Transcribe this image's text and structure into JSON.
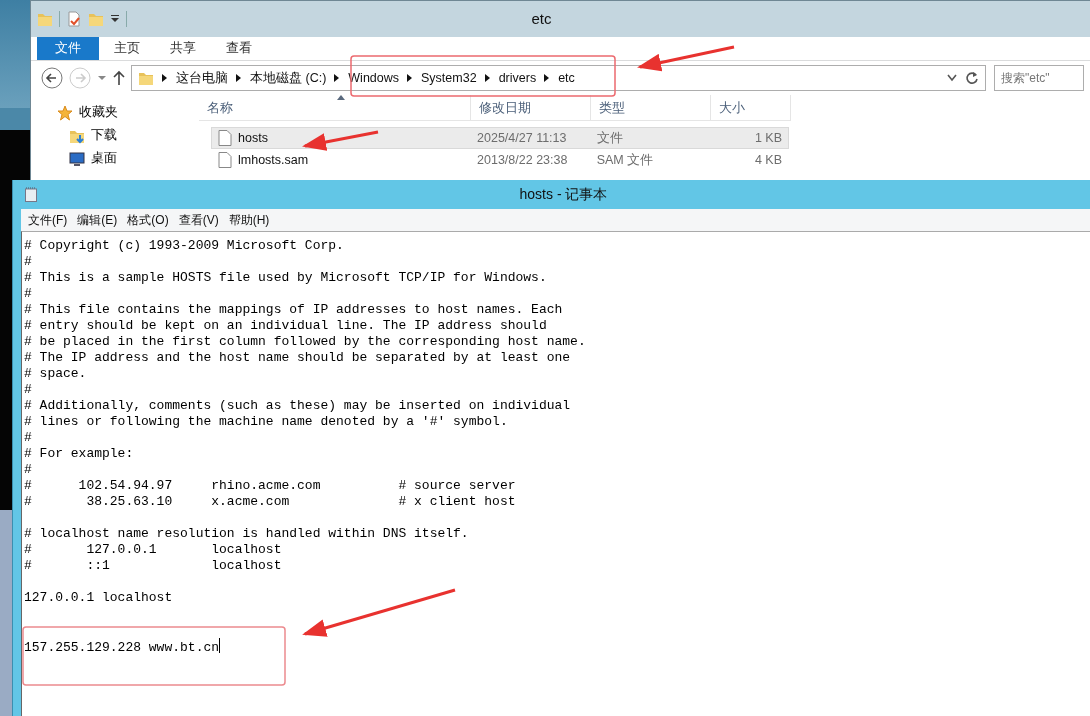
{
  "explorer": {
    "title": "etc",
    "ribbon_tabs": [
      {
        "label": "文件",
        "selected": true
      },
      {
        "label": "主页",
        "selected": false
      },
      {
        "label": "共享",
        "selected": false
      },
      {
        "label": "查看",
        "selected": false
      }
    ],
    "breadcrumb": [
      "这台电脑",
      "本地磁盘 (C:)",
      "Windows",
      "System32",
      "drivers",
      "etc"
    ],
    "search": {
      "placeholder": "搜索\"etc\""
    },
    "nav_pane": [
      {
        "label": "收藏夹",
        "kind": "star"
      },
      {
        "label": "下载",
        "kind": "download"
      },
      {
        "label": "桌面",
        "kind": "desktop"
      }
    ],
    "columns": [
      "名称",
      "修改日期",
      "类型",
      "大小"
    ],
    "rows": [
      {
        "name": "hosts",
        "date": "2025/4/27 11:13",
        "type": "文件",
        "size": "1 KB",
        "selected": true
      },
      {
        "name": "lmhosts.sam",
        "date": "2013/8/22 23:38",
        "type": "SAM 文件",
        "size": "4 KB",
        "selected": false
      }
    ]
  },
  "notepad": {
    "title": "hosts - 记事本",
    "menu": [
      "文件(F)",
      "编辑(E)",
      "格式(O)",
      "查看(V)",
      "帮助(H)"
    ],
    "lines": [
      {
        "kind": "text",
        "text": "# Copyright (c) 1993-2009 Microsoft Corp."
      },
      {
        "kind": "text",
        "text": "#"
      },
      {
        "kind": "text",
        "text": "# This is a sample HOSTS file used by Microsoft TCP/IP for Windows."
      },
      {
        "kind": "text",
        "text": "#"
      },
      {
        "kind": "text",
        "text": "# This file contains the mappings of IP addresses to host names. Each"
      },
      {
        "kind": "text",
        "text": "# entry should be kept on an individual line. The IP address should"
      },
      {
        "kind": "text",
        "text": "# be placed in the first column followed by the corresponding host name."
      },
      {
        "kind": "text",
        "text": "# The IP address and the host name should be separated by at least one"
      },
      {
        "kind": "text",
        "text": "# space."
      },
      {
        "kind": "text",
        "text": "#"
      },
      {
        "kind": "text",
        "text": "# Additionally, comments (such as these) may be inserted on individual"
      },
      {
        "kind": "text",
        "text": "# lines or following the machine name denoted by a '#' symbol."
      },
      {
        "kind": "text",
        "text": "#"
      },
      {
        "kind": "text",
        "text": "# For example:"
      },
      {
        "kind": "text",
        "text": "#"
      },
      {
        "kind": "text",
        "text": "#      102.54.94.97     rhino.acme.com          # source server"
      },
      {
        "kind": "text",
        "text": "#       38.25.63.10     x.acme.com              # x client host"
      },
      {
        "kind": "blank"
      },
      {
        "kind": "text",
        "text": "# localhost name resolution is handled within DNS itself."
      },
      {
        "kind": "text",
        "text": "#       127.0.0.1       localhost"
      },
      {
        "kind": "text",
        "text": "#       ::1             localhost"
      },
      {
        "kind": "blank"
      },
      {
        "kind": "text",
        "text": "127.0.0.1 localhost"
      },
      {
        "kind": "blank"
      },
      {
        "kind": "blank"
      },
      {
        "kind": "cursor",
        "text": "157.255.129.228 www.bt.cn"
      }
    ]
  }
}
